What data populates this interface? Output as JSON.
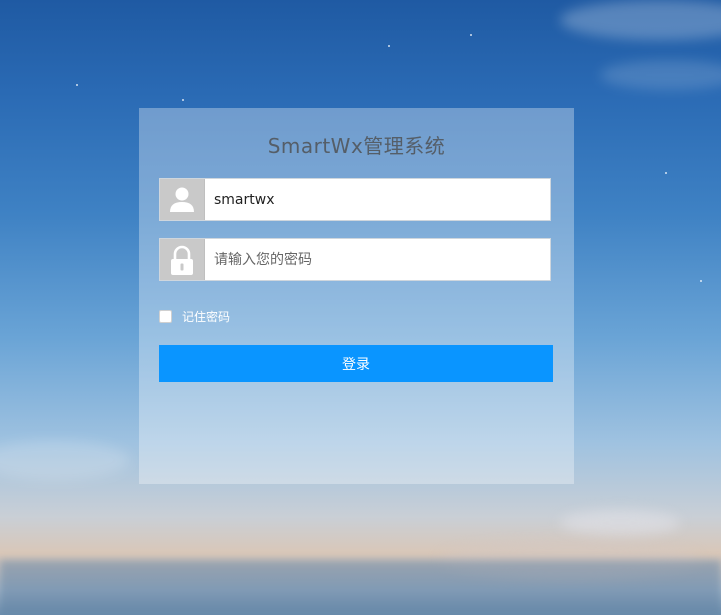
{
  "app": {
    "title": "SmartWx管理系统"
  },
  "login_form": {
    "username": {
      "value": "smartwx",
      "icon": "user-icon"
    },
    "password": {
      "value": "",
      "placeholder": "请输入您的密码",
      "icon": "lock-icon"
    },
    "remember_label": "记住密码",
    "remember_checked": false,
    "submit_label": "登录"
  },
  "colors": {
    "primary_button": "#0a95ff",
    "icon_box": "#c9c9c9",
    "title_text": "#555e68"
  }
}
